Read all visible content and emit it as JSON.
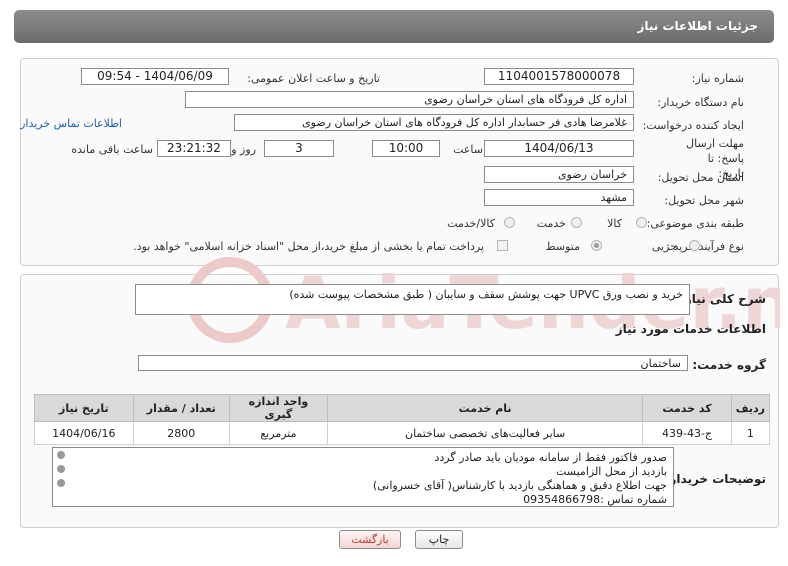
{
  "header": {
    "title": "جزئیات اطلاعات نیاز"
  },
  "form": {
    "need_number_label": "شماره نیاز:",
    "need_number": "1104001578000078",
    "announce_label": "تاریخ و ساعت اعلان عمومی:",
    "announce_value": "1404/06/09 - 09:54",
    "buyer_org_label": "نام دستگاه خریدار:",
    "buyer_org": "اداره کل فرودگاه های استان خراسان رضوی",
    "creator_label": "ایجاد کننده درخواست:",
    "creator": "غلامرضا هادی فر حسابدار اداره کل فرودگاه های استان خراسان رضوی",
    "contact_link": "اطلاعات تماس خریدار",
    "deadline_label": "مهلت ارسال پاسخ: تا تاریخ:",
    "deadline_date": "1404/06/13",
    "time_label": "ساعت",
    "deadline_time": "10:00",
    "days": "3",
    "days_label": "روز و",
    "remaining": "23:21:32",
    "remaining_label": "ساعت باقی مانده",
    "province_label": "استان محل تحویل:",
    "province": "خراسان رضوی",
    "city_label": "شهر محل تحویل:",
    "city": "مشهد",
    "category_label": "طبقه بندی موضوعی:",
    "category_options": [
      "کالا",
      "خدمت",
      "کالا/خدمت"
    ],
    "process_label": "نوع فرآیند خرید :",
    "process_options": [
      "جزیی",
      "متوسط"
    ],
    "payment_note": "پرداخت تمام یا بخشی از مبلغ خرید،از محل \"اسناد خزانه اسلامی\" خواهد بود."
  },
  "summary": {
    "label": "شرح کلی نیاز:",
    "text": "خرید و نصب ورق UPVC جهت پوشش سقف  و سایبان ( طبق مشخصات پیوست شده)"
  },
  "services": {
    "section_title": "اطلاعات خدمات مورد نیاز",
    "group_label": "گروه خدمت:",
    "group_value": "ساختمان",
    "columns": [
      "ردیف",
      "کد خدمت",
      "نام خدمت",
      "واحد اندازه گیری",
      "تعداد / مقدار",
      "تاریخ نیاز"
    ],
    "rows": [
      {
        "row": "1",
        "code": "ج-43-439",
        "name": "سایر فعالیت‌های تخصصی ساختمان",
        "unit": "مترمربع",
        "qty": "2800",
        "date": "1404/06/16"
      }
    ]
  },
  "notes": {
    "label": "توضیحات خریدار:",
    "lines": [
      "صدور فاکتور فقط از سامانه مودیان باید صادر گردد",
      "بازدید از محل الزامیست",
      "جهت اطلاع دقیق و هماهنگی بازدید با کارشناس( آقای خسروانی)",
      "شماره تماس :09354866798"
    ]
  },
  "buttons": {
    "print": "چاپ",
    "back": "بازگشت"
  },
  "watermark": {
    "text": "AriaTender.net"
  },
  "colors": {
    "header": "#7a7a7a",
    "link": "#1a5fb4",
    "back_button_text": "#c0392b",
    "watermark": "#e3b5b5"
  }
}
